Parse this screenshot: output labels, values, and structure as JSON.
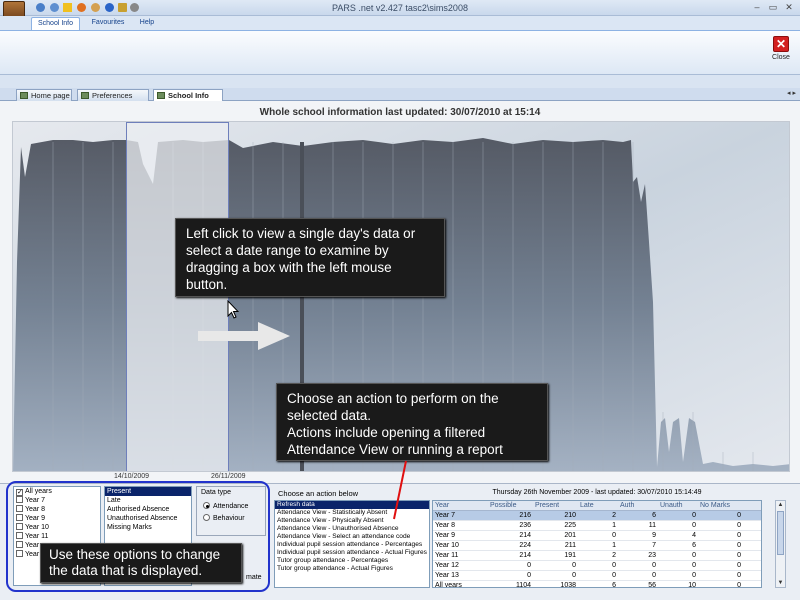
{
  "window": {
    "title": "PARS .net v2.427  tasc2\\sims2008",
    "min": "–",
    "max": "▭",
    "close": "✕"
  },
  "menu": {
    "tabs": [
      {
        "label": "School Info"
      },
      {
        "label": "Favourites"
      },
      {
        "label": "Help"
      }
    ]
  },
  "ribbon": {
    "close_label": "Close"
  },
  "doc_tabs": [
    {
      "label": "Home page"
    },
    {
      "label": "Preferences"
    },
    {
      "label": "School Info"
    }
  ],
  "page": {
    "heading": "Whole school information last updated: 30/07/2010 at 15:14"
  },
  "chart_data": {
    "type": "area",
    "title": "",
    "xlabel": "",
    "ylabel": "",
    "selected_range": [
      "14/10/2009",
      "26/11/2009"
    ],
    "date_labels": [
      "14/10/2009",
      "26/11/2009"
    ]
  },
  "callouts": {
    "chart_help": "Left click to view a single day's data or select a date range to examine by dragging a box with the left mouse button.",
    "actions_help_1": "Choose an action to perform on the selected data.",
    "actions_help_2": "Actions include opening a filtered Attendance View or running a report",
    "options_help": "Use these options to change the data that is displayed."
  },
  "years": [
    {
      "label": "All years",
      "checked": true
    },
    {
      "label": "Year  7",
      "checked": false
    },
    {
      "label": "Year  8",
      "checked": false
    },
    {
      "label": "Year  9",
      "checked": false
    },
    {
      "label": "Year 10",
      "checked": false
    },
    {
      "label": "Year 11",
      "checked": false
    },
    {
      "label": "Year",
      "checked": false
    },
    {
      "label": "Year",
      "checked": false
    }
  ],
  "marks": [
    "Present",
    "Late",
    "Authorised Absence",
    "Unauthorised Absence",
    "Missing Marks"
  ],
  "data_type": {
    "label": "Data type",
    "options": [
      "Attendance",
      "Behaviour"
    ],
    "selected": "Attendance",
    "extra": "mate"
  },
  "actions": {
    "label": "Choose an action below",
    "items": [
      "Refresh data",
      "Attendance View - Statistically Absent",
      "Attendance View - Physically Absent",
      "Attendance View - Unauthorised Absence",
      "Attendance View - Select an attendance code",
      "Individual pupil session attendance - Percentages",
      "Individual pupil session attendance - Actual Figures",
      "Tutor group attendance - Percentages",
      "Tutor group attendance - Actual Figures"
    ]
  },
  "table": {
    "info": "Thursday 26th November 2009 - last updated: 30/07/2010 15:14:49",
    "columns": [
      "Year",
      "Possible",
      "Present",
      "Late",
      "Auth",
      "Unauth",
      "No Marks"
    ],
    "rows": [
      [
        "Year 7",
        "216",
        "210",
        "2",
        "6",
        "0",
        "0"
      ],
      [
        "Year 8",
        "236",
        "225",
        "1",
        "11",
        "0",
        "0"
      ],
      [
        "Year 9",
        "214",
        "201",
        "0",
        "9",
        "4",
        "0"
      ],
      [
        "Year 10",
        "224",
        "211",
        "1",
        "7",
        "6",
        "0"
      ],
      [
        "Year 11",
        "214",
        "191",
        "2",
        "23",
        "0",
        "0"
      ],
      [
        "Year 12",
        "0",
        "0",
        "0",
        "0",
        "0",
        "0"
      ],
      [
        "Year 13",
        "0",
        "0",
        "0",
        "0",
        "0",
        "0"
      ],
      [
        "All years",
        "1104",
        "1038",
        "6",
        "56",
        "10",
        "0"
      ]
    ]
  },
  "colors": {
    "selection": "#0a246a",
    "accent": "#2233cc",
    "close_red": "#d32020"
  }
}
